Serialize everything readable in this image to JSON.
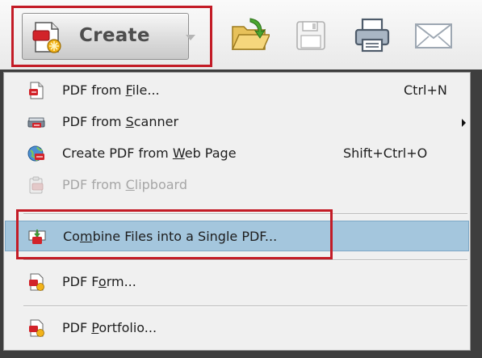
{
  "toolbar": {
    "create_button": {
      "label": "Create",
      "icon": "create-pdf-icon"
    },
    "icons": [
      "open-folder-icon",
      "save-icon",
      "print-icon",
      "email-icon"
    ]
  },
  "menu": {
    "items": [
      {
        "pre": "PDF from ",
        "u": "F",
        "post": "ile...",
        "shortcut": "Ctrl+N",
        "icon": "pdf-from-file-icon",
        "enabled": true
      },
      {
        "pre": "PDF from ",
        "u": "S",
        "post": "canner",
        "shortcut": "",
        "submenu": true,
        "icon": "scanner-icon",
        "enabled": true
      },
      {
        "pre": "Create PDF from ",
        "u": "W",
        "post": "eb Page",
        "shortcut": "Shift+Ctrl+O",
        "icon": "web-page-icon",
        "enabled": true
      },
      {
        "pre": "PDF from ",
        "u": "C",
        "post": "lipboard",
        "shortcut": "",
        "icon": "clipboard-icon",
        "enabled": false
      },
      {
        "pre": "Co",
        "u": "m",
        "post": "bine Files into a Single PDF...",
        "shortcut": "",
        "icon": "combine-files-icon",
        "enabled": true,
        "selected": true
      },
      {
        "pre": "PDF F",
        "u": "o",
        "post": "rm...",
        "shortcut": "",
        "icon": "pdf-form-icon",
        "enabled": true
      },
      {
        "pre": "PDF ",
        "u": "P",
        "post": "ortfolio...",
        "shortcut": "",
        "icon": "pdf-portfolio-icon",
        "enabled": true
      }
    ]
  },
  "colors": {
    "highlight_border": "#c31b26",
    "menu_selection": "#a4c6dd",
    "menu_background": "#f0f0f0",
    "pdf_red": "#d2232a",
    "accent_gold": "#f2b31a"
  }
}
